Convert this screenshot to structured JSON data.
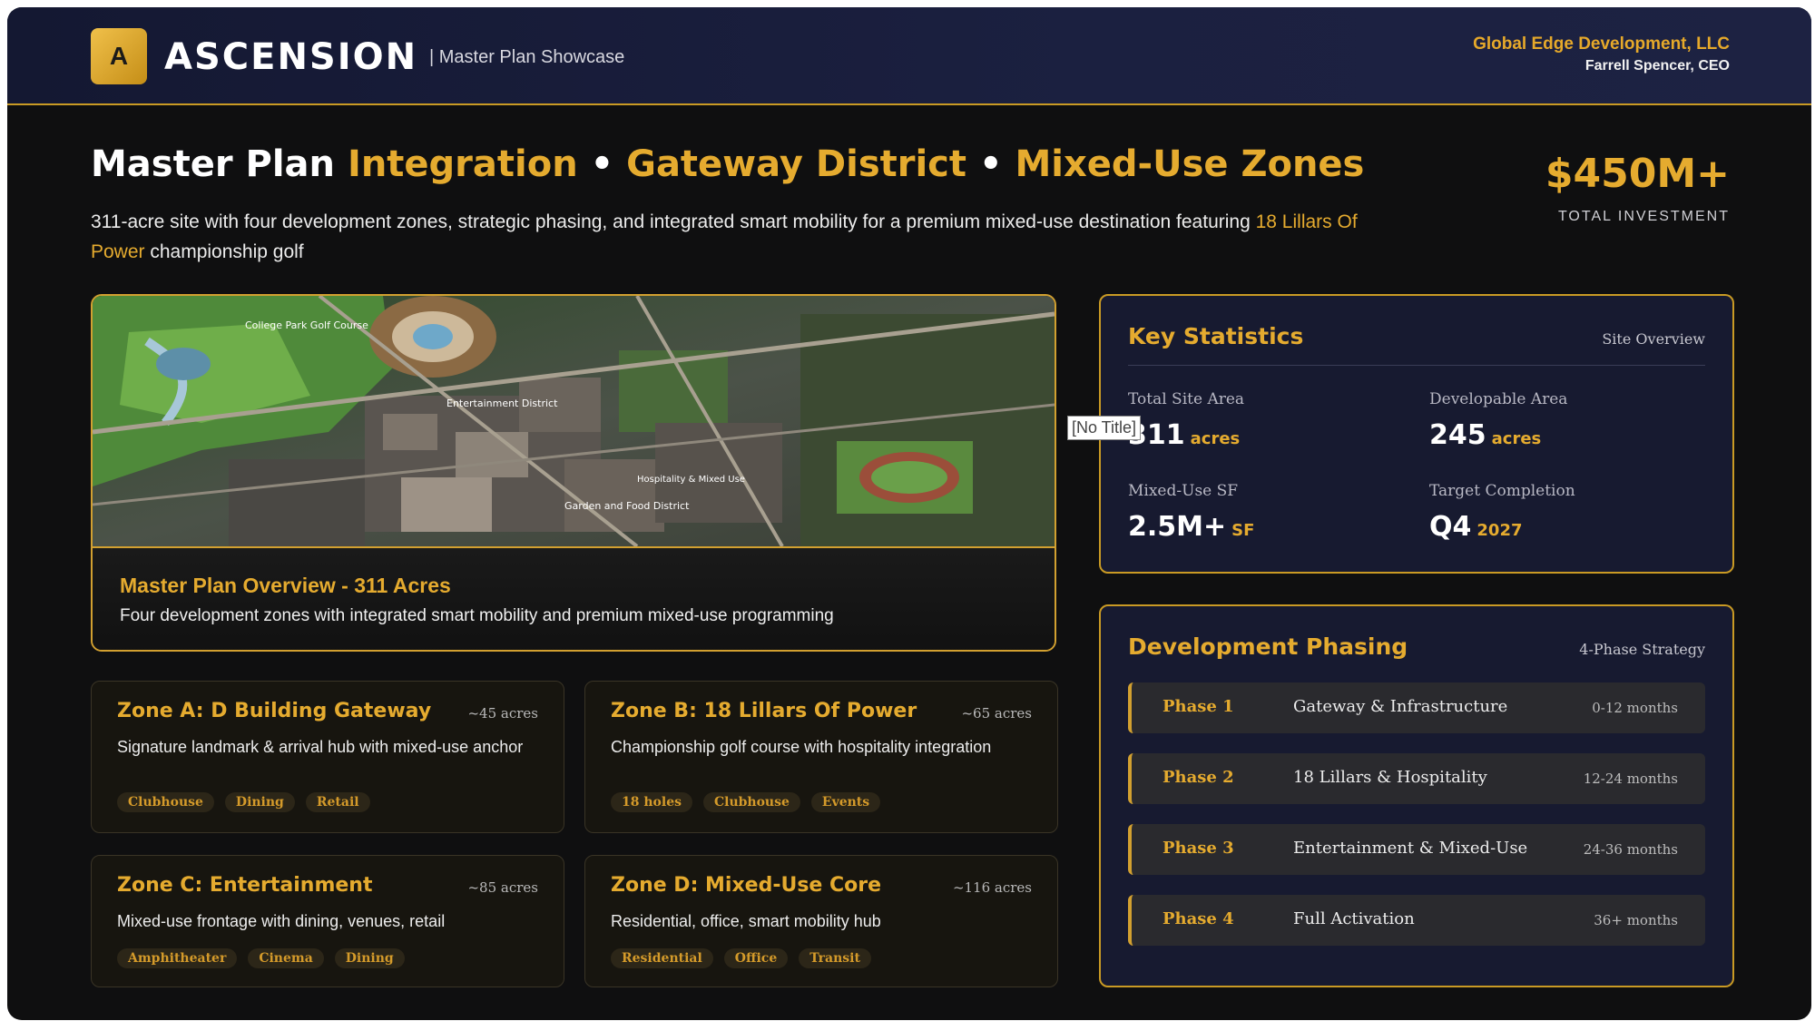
{
  "header": {
    "logo_letter": "A",
    "brand": "ASCENSION",
    "subtitle": "| Master Plan Showcase",
    "company": "Global Edge Development, LLC",
    "ceo": "Farrell Spencer, CEO"
  },
  "hero": {
    "title_part1": "Master Plan ",
    "title_part2": "Integration",
    "title_sep1": " • ",
    "title_part3": "Gateway District",
    "title_sep2": " • ",
    "title_part4": "Mixed-Use Zones",
    "desc_part1": "311-acre site with four development zones, strategic phasing, and integrated smart mobility for a premium mixed-use destination featuring ",
    "desc_highlight": "18 Lillars Of Power",
    "desc_part2": " championship golf",
    "investment_value": "$450M+",
    "investment_label": "TOTAL INVESTMENT"
  },
  "plan": {
    "title": "Master Plan Overview - 311 Acres",
    "description": "Four development zones with integrated smart mobility and premium mixed-use programming",
    "map_labels": {
      "golf": "College Park Golf Course",
      "entertainment": "Entertainment District",
      "hospitality": "Hospitality & Mixed Use",
      "garden": "Garden and Food District"
    }
  },
  "zones": [
    {
      "title": "Zone A: D Building Gateway",
      "acres": "~45 acres",
      "description": "Signature landmark & arrival hub with mixed-use anchor",
      "tags": [
        "Clubhouse",
        "Dining",
        "Retail"
      ]
    },
    {
      "title": "Zone B: 18 Lillars Of Power",
      "acres": "~65 acres",
      "description": "Championship golf course with hospitality integration",
      "tags": [
        "18 holes",
        "Clubhouse",
        "Events"
      ]
    },
    {
      "title": "Zone C: Entertainment",
      "acres": "~85 acres",
      "description": "Mixed-use frontage with dining, venues, retail",
      "tags": [
        "Amphitheater",
        "Cinema",
        "Dining"
      ]
    },
    {
      "title": "Zone D: Mixed-Use Core",
      "acres": "~116 acres",
      "description": "Residential, office, smart mobility hub",
      "tags": [
        "Residential",
        "Office",
        "Transit"
      ]
    }
  ],
  "stats": {
    "title": "Key Statistics",
    "tag": "Site Overview",
    "items": [
      {
        "label": "Total Site Area",
        "value": "311",
        "unit": "acres"
      },
      {
        "label": "Developable Area",
        "value": "245",
        "unit": "acres"
      },
      {
        "label": "Mixed-Use SF",
        "value": "2.5M+",
        "unit": "SF"
      },
      {
        "label": "Target Completion",
        "value": "Q4",
        "unit": "2027"
      }
    ]
  },
  "phasing": {
    "title": "Development Phasing",
    "tag": "4-Phase Strategy",
    "phases": [
      {
        "name": "Phase 1",
        "description": "Gateway & Infrastructure",
        "duration": "0-12 months"
      },
      {
        "name": "Phase 2",
        "description": "18 Lillars & Hospitality",
        "duration": "12-24 months"
      },
      {
        "name": "Phase 3",
        "description": "Entertainment & Mixed-Use",
        "duration": "24-36 months"
      },
      {
        "name": "Phase 4",
        "description": "Full Activation",
        "duration": "36+ months"
      }
    ]
  },
  "tooltip": "[No Title]",
  "colors": {
    "accent": "#e5ab2f",
    "panel_bg": "#171a30",
    "page_bg": "#0f0f10"
  }
}
